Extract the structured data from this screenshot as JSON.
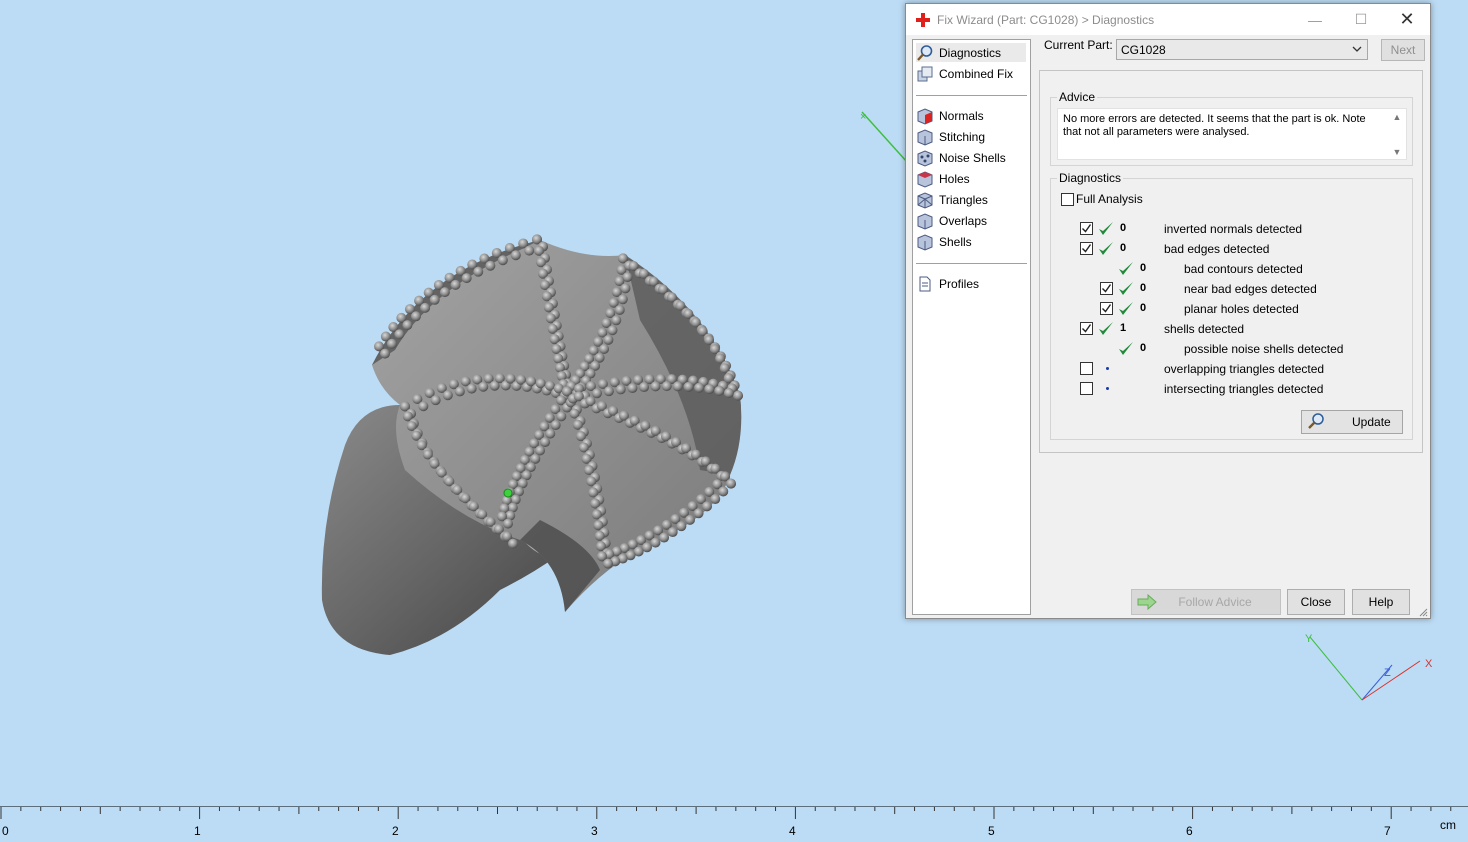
{
  "dialog": {
    "title": "Fix Wizard (Part: CG1028) > Diagnostics",
    "current_part_label": "Current Part:",
    "current_part_value": "CG1028",
    "next_label": "Next",
    "follow_advice_label": "Follow Advice",
    "close_label": "Close",
    "help_label": "Help"
  },
  "nav": {
    "items": [
      {
        "label": "Diagnostics",
        "icon": "magnifier-icon"
      },
      {
        "label": "Combined Fix",
        "icon": "combined-fix-icon"
      },
      {
        "label": "Normals",
        "icon": "normals-cube-icon"
      },
      {
        "label": "Stitching",
        "icon": "stitching-cube-icon"
      },
      {
        "label": "Noise Shells",
        "icon": "noise-shells-icon"
      },
      {
        "label": "Holes",
        "icon": "holes-cube-icon"
      },
      {
        "label": "Triangles",
        "icon": "triangles-cube-icon"
      },
      {
        "label": "Overlaps",
        "icon": "overlaps-cube-icon"
      },
      {
        "label": "Shells",
        "icon": "shells-cube-icon"
      },
      {
        "label": "Profiles",
        "icon": "document-icon"
      }
    ],
    "selected": "Diagnostics"
  },
  "advice": {
    "group_label": "Advice",
    "text": "No more errors are detected. It seems that the part is ok. Note that not all parameters were analysed."
  },
  "diagnostics": {
    "group_label": "Diagnostics",
    "full_analysis_label": "Full Analysis",
    "full_analysis_checked": false,
    "update_label": "Update",
    "rows": [
      {
        "checked": true,
        "status": "ok",
        "count": "0",
        "label": "inverted normals detected",
        "indent": 0
      },
      {
        "checked": true,
        "status": "ok",
        "count": "0",
        "label": "bad edges detected",
        "indent": 0
      },
      {
        "checked": null,
        "status": "ok",
        "count": "0",
        "label": "bad contours detected",
        "indent": 1
      },
      {
        "checked": true,
        "status": "ok",
        "count": "0",
        "label": "near bad edges detected",
        "indent": 1
      },
      {
        "checked": true,
        "status": "ok",
        "count": "0",
        "label": "planar holes detected",
        "indent": 1
      },
      {
        "checked": true,
        "status": "ok",
        "count": "1",
        "label": "shells detected",
        "indent": 0
      },
      {
        "checked": null,
        "status": "ok",
        "count": "0",
        "label": "possible noise shells detected",
        "indent": 1
      },
      {
        "checked": false,
        "status": "unknown",
        "count": "",
        "label": "overlapping triangles detected",
        "indent": 0
      },
      {
        "checked": false,
        "status": "unknown",
        "count": "",
        "label": "intersecting triangles detected",
        "indent": 0
      }
    ]
  },
  "ruler": {
    "labels": [
      "0",
      "1",
      "2",
      "3",
      "4",
      "5",
      "6",
      "7"
    ],
    "unit": "cm"
  },
  "axes": {
    "x_label": "X",
    "y_label": "Y",
    "z_label": "Z"
  },
  "colors": {
    "viewport_bg": "#bcdcf5",
    "check_green": "#1f8a3a",
    "model_gray": "#6f6f6f"
  }
}
